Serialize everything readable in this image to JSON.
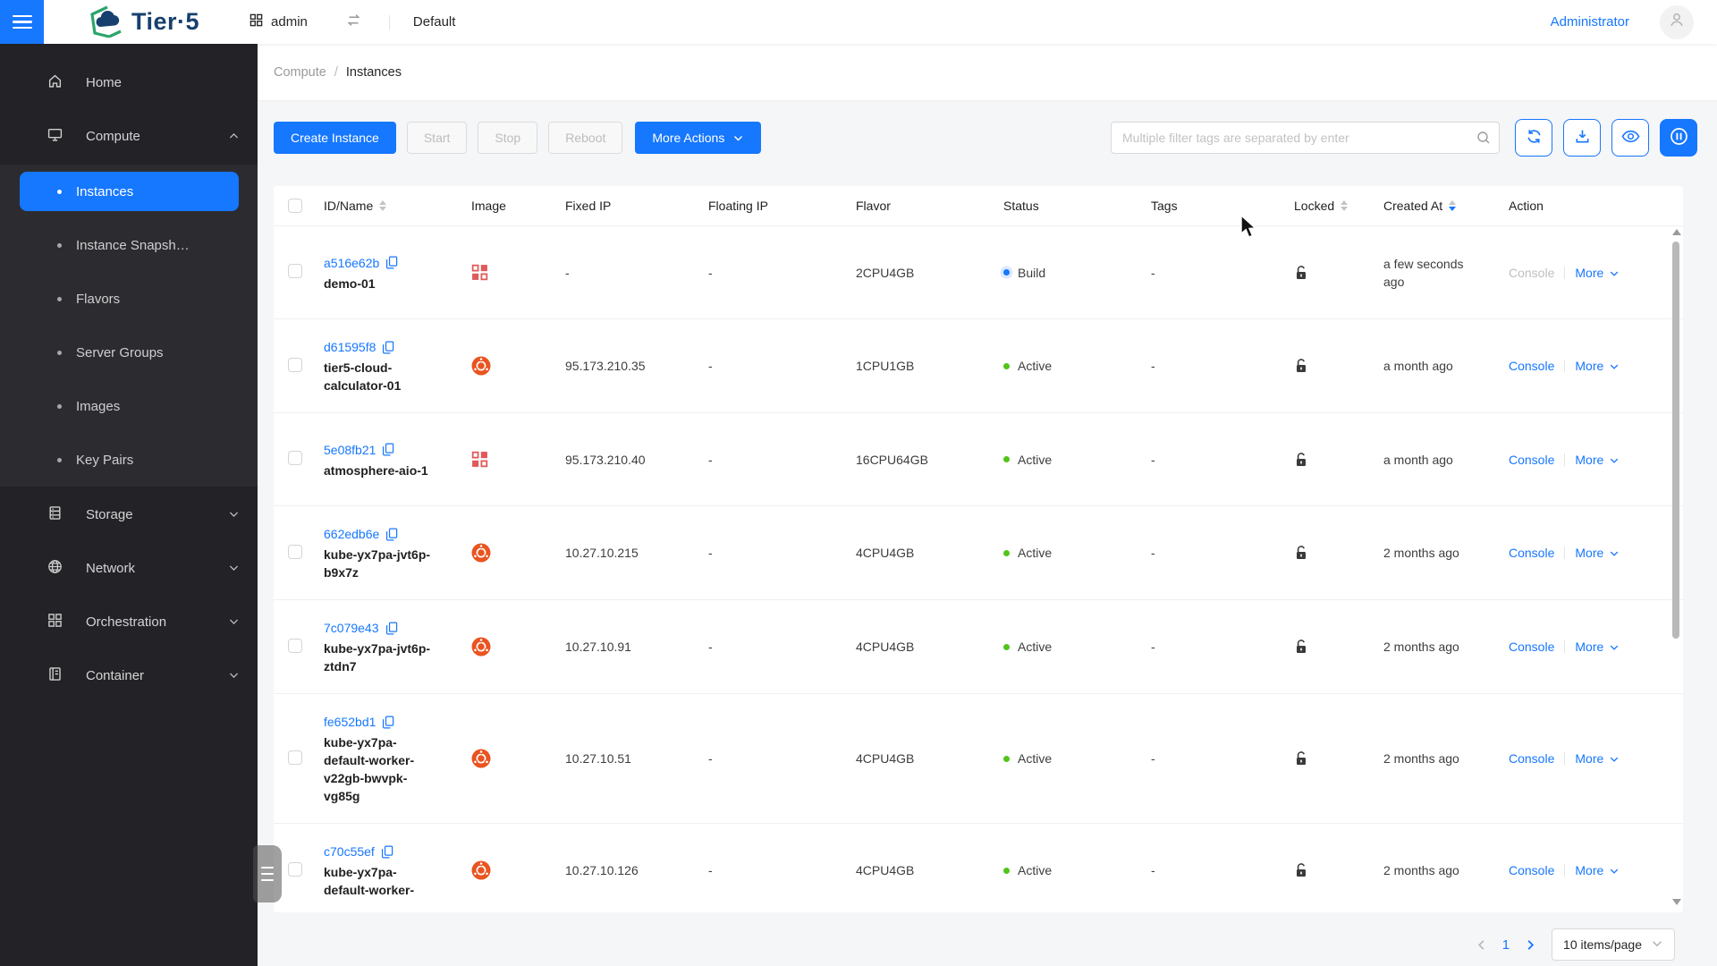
{
  "header": {
    "brand": "Tier·5",
    "workspace": "admin",
    "scope": "Default",
    "user": "Administrator"
  },
  "sidebar": {
    "home": "Home",
    "compute": "Compute",
    "compute_children": [
      "Instances",
      "Instance Snapsh…",
      "Flavors",
      "Server Groups",
      "Images",
      "Key Pairs"
    ],
    "active_child": "Instances",
    "storage": "Storage",
    "network": "Network",
    "orchestration": "Orchestration",
    "container": "Container"
  },
  "breadcrumb": {
    "section": "Compute",
    "sep": "/",
    "page": "Instances"
  },
  "toolbar": {
    "create": "Create Instance",
    "start": "Start",
    "stop": "Stop",
    "reboot": "Reboot",
    "more_actions": "More Actions"
  },
  "filter": {
    "placeholder": "Multiple filter tags are separated by enter"
  },
  "icons": {
    "menu": "hamburger-icon",
    "workspace": "grid-icon",
    "switch": "swap-icon",
    "search": "search-icon",
    "refresh": "refresh-icon",
    "export": "download-icon",
    "visibility": "eye-icon",
    "auto_refresh": "pause-circle-icon",
    "copy": "copy-icon",
    "unlocked": "unlock-icon",
    "ubuntu_image": "ubuntu-logo-icon",
    "other_image": "image-grid-icon",
    "user": "user-icon"
  },
  "table": {
    "columns": [
      "ID/Name",
      "Image",
      "Fixed IP",
      "Floating IP",
      "Flavor",
      "Status",
      "Tags",
      "Locked",
      "Created At",
      "Action"
    ],
    "action_labels": {
      "console": "Console",
      "more": "More"
    },
    "status_colors": {
      "Active": "#52c41a",
      "Build": "#1677ff"
    },
    "rows": [
      {
        "id": "a516e62b",
        "name": "demo-01",
        "image": "other",
        "fixed_ip": "-",
        "floating_ip": "-",
        "flavor": "2CPU4GB",
        "status": "Build",
        "tags": "-",
        "locked": false,
        "created": "a few seconds ago",
        "console_enabled": false
      },
      {
        "id": "d61595f8",
        "name": "tier5-cloud-calculator-01",
        "image": "ubuntu",
        "fixed_ip": "95.173.210.35",
        "floating_ip": "-",
        "flavor": "1CPU1GB",
        "status": "Active",
        "tags": "-",
        "locked": false,
        "created": "a month ago",
        "console_enabled": true
      },
      {
        "id": "5e08fb21",
        "name": "atmosphere-aio-1",
        "image": "other",
        "fixed_ip": "95.173.210.40",
        "floating_ip": "-",
        "flavor": "16CPU64GB",
        "status": "Active",
        "tags": "-",
        "locked": false,
        "created": "a month ago",
        "console_enabled": true
      },
      {
        "id": "662edb6e",
        "name": "kube-yx7pa-jvt6p-b9x7z",
        "image": "ubuntu",
        "fixed_ip": "10.27.10.215",
        "floating_ip": "-",
        "flavor": "4CPU4GB",
        "status": "Active",
        "tags": "-",
        "locked": false,
        "created": "2 months ago",
        "console_enabled": true
      },
      {
        "id": "7c079e43",
        "name": "kube-yx7pa-jvt6p-ztdn7",
        "image": "ubuntu",
        "fixed_ip": "10.27.10.91",
        "floating_ip": "-",
        "flavor": "4CPU4GB",
        "status": "Active",
        "tags": "-",
        "locked": false,
        "created": "2 months ago",
        "console_enabled": true
      },
      {
        "id": "fe652bd1",
        "name": "kube-yx7pa-default-worker-v22gb-bwvpk-vg85g",
        "image": "ubuntu",
        "fixed_ip": "10.27.10.51",
        "floating_ip": "-",
        "flavor": "4CPU4GB",
        "status": "Active",
        "tags": "-",
        "locked": false,
        "created": "2 months ago",
        "console_enabled": true
      },
      {
        "id": "c70c55ef",
        "name": "kube-yx7pa-default-worker-",
        "image": "ubuntu",
        "fixed_ip": "10.27.10.126",
        "floating_ip": "-",
        "flavor": "4CPU4GB",
        "status": "Active",
        "tags": "-",
        "locked": false,
        "created": "2 months ago",
        "console_enabled": true
      }
    ]
  },
  "pagination": {
    "page": "1",
    "page_size": "10 items/page"
  }
}
